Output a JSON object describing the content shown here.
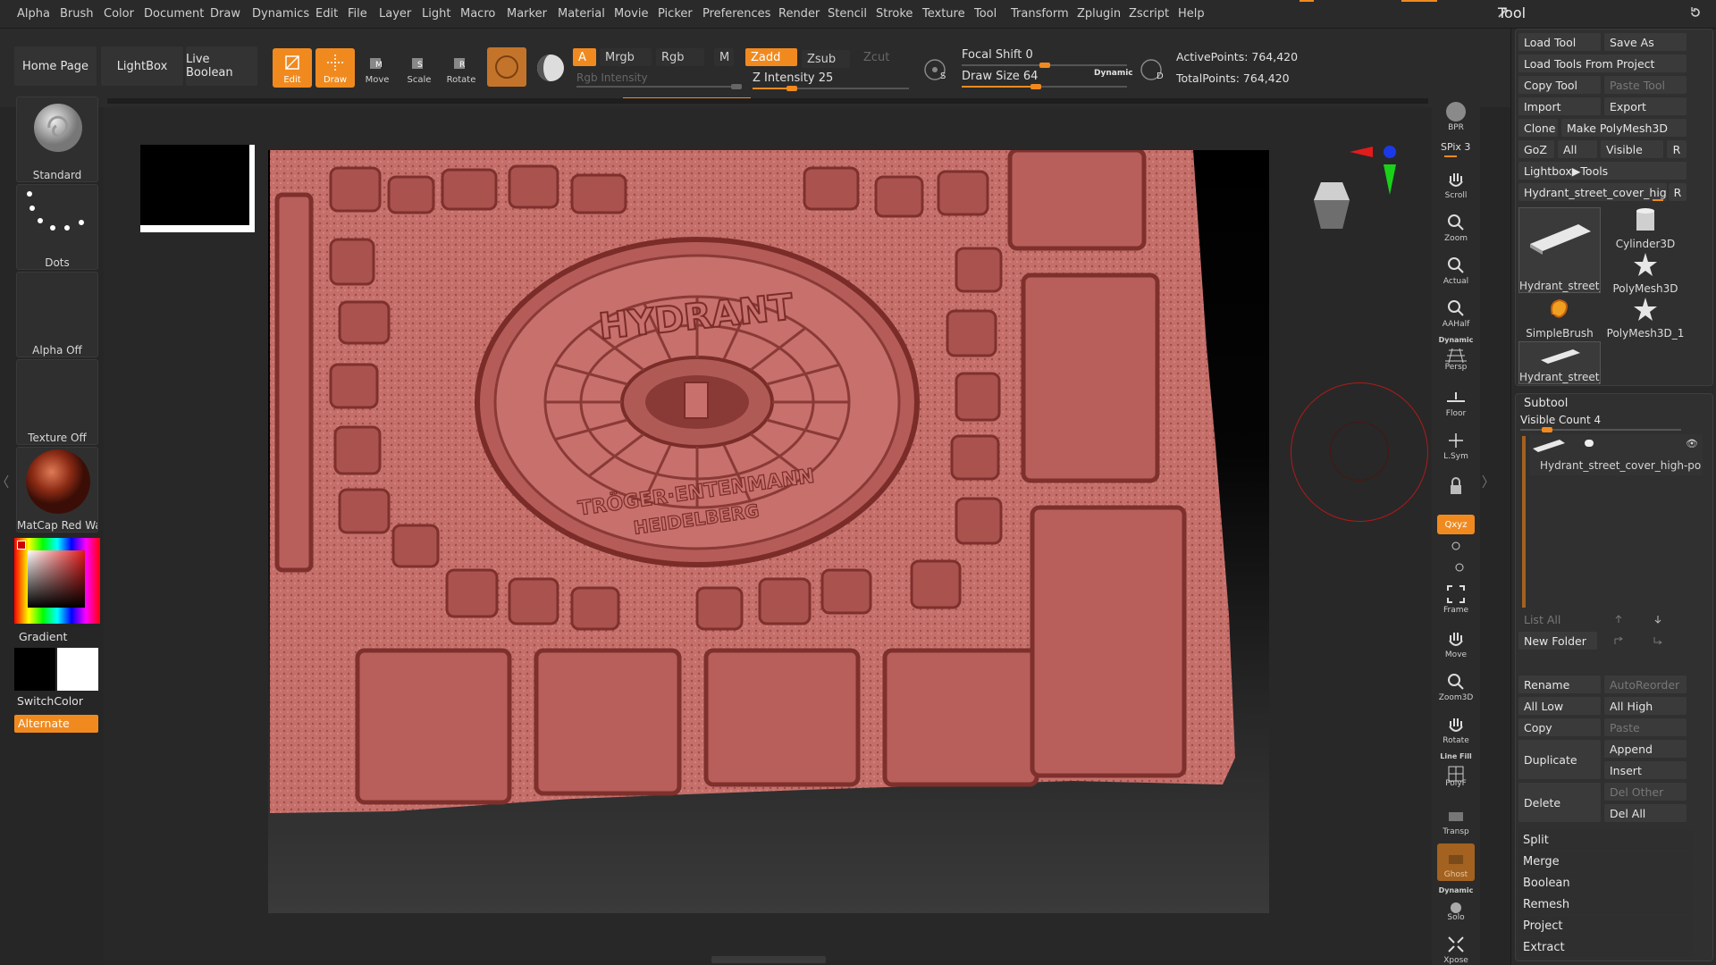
{
  "menu": [
    "Alpha",
    "Brush",
    "Color",
    "Document",
    "Draw",
    "Dynamics",
    "Edit",
    "File",
    "Layer",
    "Light",
    "Macro",
    "Marker",
    "Material",
    "Movie",
    "Picker",
    "Preferences",
    "Render",
    "Stencil",
    "Stroke",
    "Texture",
    "Tool",
    "Transform",
    "Zplugin",
    "Zscript",
    "Help"
  ],
  "palette_title": "Tool",
  "top": {
    "home": "Home Page",
    "lightbox": "LightBox",
    "live_boolean": "Live Boolean",
    "edit": "Edit",
    "draw": "Draw",
    "move": "Move",
    "scale": "Scale",
    "rotate": "Rotate",
    "a": "A",
    "mrgb": "Mrgb",
    "rgb": "Rgb",
    "m": "M",
    "zadd": "Zadd",
    "zsub": "Zsub",
    "zcut": "Zcut",
    "rgb_intensity": "Rgb Intensity",
    "z_intensity": "Z Intensity 25",
    "focal_shift": "Focal Shift 0",
    "draw_size": "Draw Size 64",
    "dynamic": "Dynamic",
    "active_points": "ActivePoints: 764,420",
    "total_points": "TotalPoints: 764,420",
    "s_label": "S",
    "d_label": "D",
    "z_intensity_level": 0.25,
    "draw_size_level": 0.45,
    "focal_shift_level": 0.5
  },
  "left": {
    "brush": "Standard",
    "stroke": "Dots",
    "alpha": "Alpha Off",
    "texture": "Texture Off",
    "material": "MatCap Red Wax",
    "gradient": "Gradient",
    "switch_color": "SwitchColor",
    "alternate": "Alternate"
  },
  "right_shelf": {
    "bpr": "BPR",
    "spix": "SPix 3",
    "scroll": "Scroll",
    "zoom": "Zoom",
    "actual": "Actual",
    "aahalf": "AAHalf",
    "dynamic": "Dynamic",
    "persp": "Persp",
    "floor": "Floor",
    "lsym": "L.Sym",
    "xyz": "Qxyz",
    "frame": "Frame",
    "move": "Move",
    "zoom3d": "Zoom3D",
    "rotate": "Rotate",
    "line_fill": "Line Fill",
    "polyf": "PolyF",
    "transp": "Transp",
    "ghost": "Ghost",
    "dynamic2": "Dynamic",
    "solo": "Solo",
    "xpose": "Xpose"
  },
  "tool": {
    "load_tool": "Load Tool",
    "save_as": "Save As",
    "load_from_project": "Load Tools From Project",
    "copy_tool": "Copy Tool",
    "paste_tool": "Paste Tool",
    "import": "Import",
    "export": "Export",
    "clone": "Clone",
    "make_polymesh": "Make PolyMesh3D",
    "goz": "GoZ",
    "all": "All",
    "visible": "Visible",
    "r": "R",
    "lightbox_tools": "Lightbox▶Tools",
    "current_tool": "Hydrant_street_cover_high-po",
    "thumbs": [
      "Hydrant_street_c",
      "Cylinder3D",
      "PolyMesh3D",
      "SimpleBrush",
      "PolyMesh3D_1",
      "Hydrant_street_c"
    ]
  },
  "subtool": {
    "title": "Subtool",
    "visible_count": "Visible Count 4",
    "item_name": "Hydrant_street_cover_high-pol",
    "list_all": "List All",
    "new_folder": "New Folder",
    "rename": "Rename",
    "auto_reorder": "AutoReorder",
    "all_low": "All Low",
    "all_high": "All High",
    "copy": "Copy",
    "paste": "Paste",
    "duplicate": "Duplicate",
    "append": "Append",
    "insert": "Insert",
    "delete": "Delete",
    "del_other": "Del Other",
    "del_all": "Del All",
    "split": "Split",
    "merge": "Merge",
    "boolean": "Boolean",
    "remesh": "Remesh",
    "project": "Project",
    "extract": "Extract"
  },
  "model": {
    "title_text": "HYDRANT",
    "bottom_text_1": "TRÖGER·ENTENMANN",
    "bottom_text_2": "HEIDELBERG"
  },
  "colors": {
    "accent": "#f08a1f",
    "clay": "#c26a66",
    "panel": "#2a2a2a"
  }
}
